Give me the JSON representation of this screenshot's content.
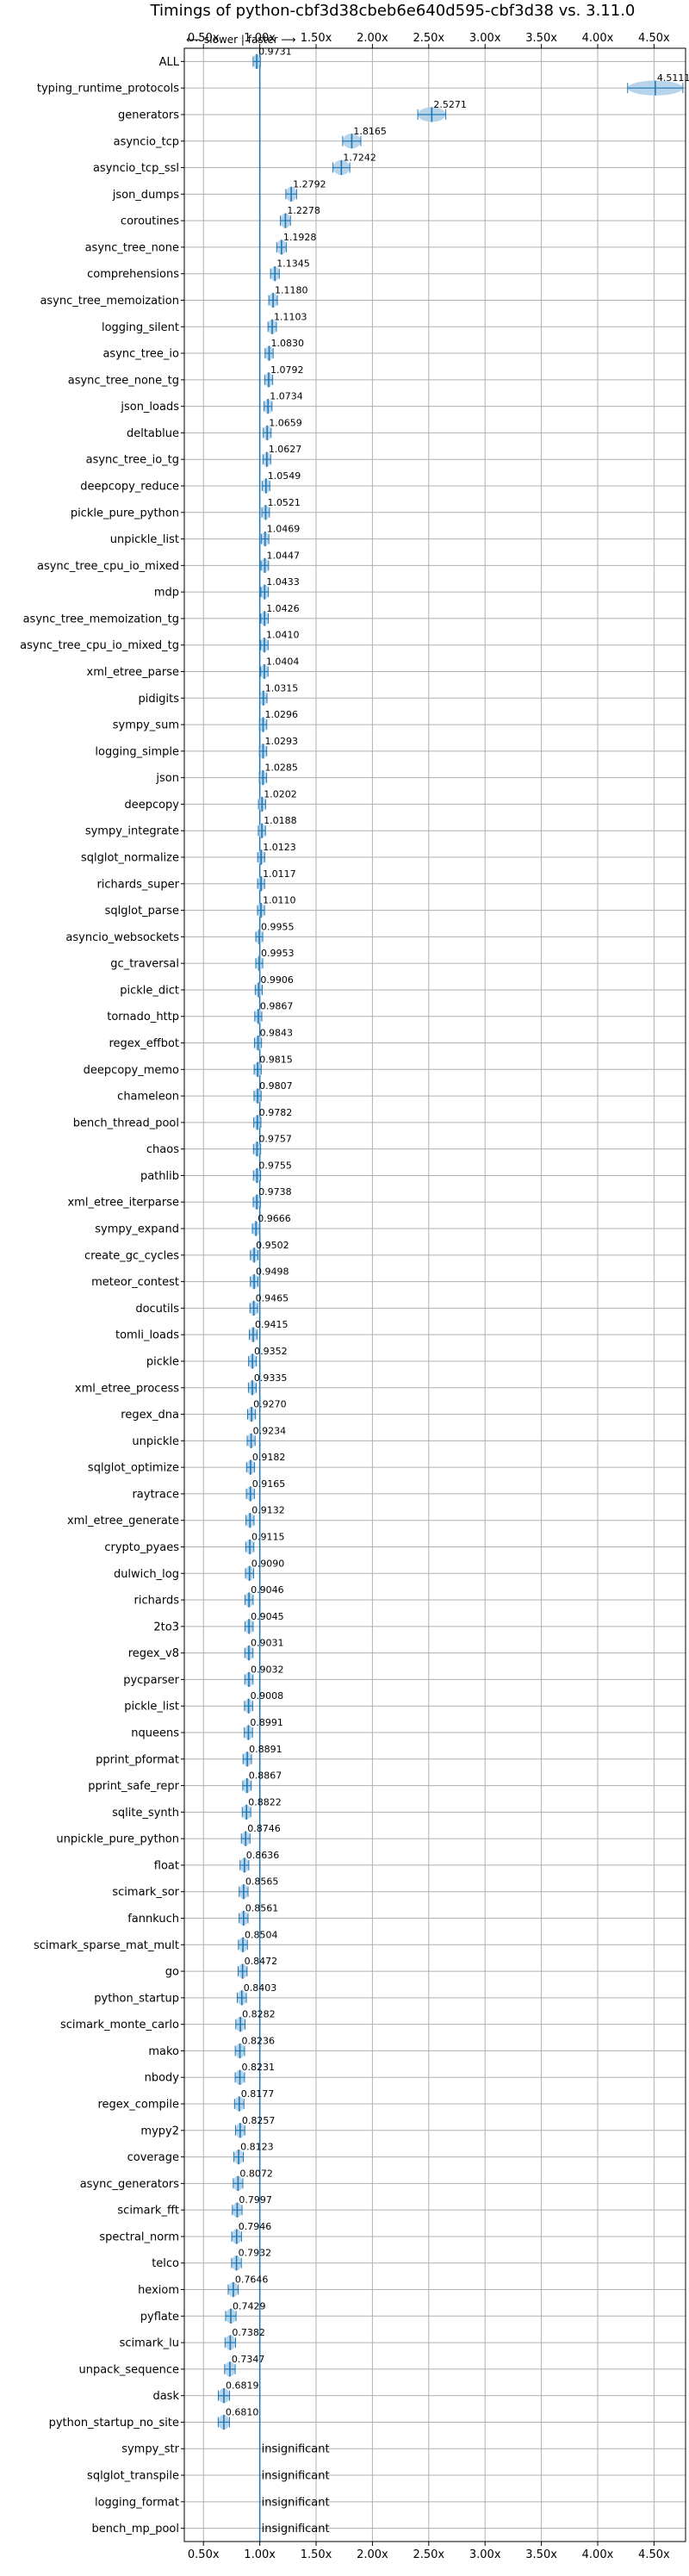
{
  "chart_data": {
    "type": "violin",
    "title": "Timings of python-cbf3d38cbeb6e640d595-cbf3d38 vs. 3.11.0",
    "direction_note": "⟵ slower | faster ⟶",
    "x_ticks": [
      "0.50x",
      "1.00x",
      "1.50x",
      "2.00x",
      "2.50x",
      "3.00x",
      "3.50x",
      "4.00x",
      "4.50x"
    ],
    "x_tick_values": [
      0.5,
      1.0,
      1.5,
      2.0,
      2.5,
      3.0,
      3.5,
      4.0,
      4.5
    ],
    "xlim": [
      0.33,
      4.78
    ],
    "reference_line": 1.0,
    "grid": true,
    "colors": {
      "violin": "#aacde6",
      "median": "#1f77b4",
      "reference": "#1f77b4",
      "mean_marker": "#d62728",
      "grid": "#b0b0b0"
    },
    "insignificant_label": "insignificant",
    "benchmarks": [
      {
        "name": "ALL",
        "value": 0.9731,
        "label": "0.9731"
      },
      {
        "name": "typing_runtime_protocols",
        "value": 4.5111,
        "label": "4.5111"
      },
      {
        "name": "generators",
        "value": 2.5271,
        "label": "2.5271"
      },
      {
        "name": "asyncio_tcp",
        "value": 1.8165,
        "label": "1.8165"
      },
      {
        "name": "asyncio_tcp_ssl",
        "value": 1.7242,
        "label": "1.7242"
      },
      {
        "name": "json_dumps",
        "value": 1.2792,
        "label": "1.2792"
      },
      {
        "name": "coroutines",
        "value": 1.2278,
        "label": "1.2278"
      },
      {
        "name": "async_tree_none",
        "value": 1.1928,
        "label": "1.1928"
      },
      {
        "name": "comprehensions",
        "value": 1.1345,
        "label": "1.1345"
      },
      {
        "name": "async_tree_memoization",
        "value": 1.118,
        "label": "1.1180"
      },
      {
        "name": "logging_silent",
        "value": 1.1103,
        "label": "1.1103"
      },
      {
        "name": "async_tree_io",
        "value": 1.083,
        "label": "1.0830"
      },
      {
        "name": "async_tree_none_tg",
        "value": 1.0792,
        "label": "1.0792"
      },
      {
        "name": "json_loads",
        "value": 1.0734,
        "label": "1.0734"
      },
      {
        "name": "deltablue",
        "value": 1.0659,
        "label": "1.0659"
      },
      {
        "name": "async_tree_io_tg",
        "value": 1.0627,
        "label": "1.0627"
      },
      {
        "name": "deepcopy_reduce",
        "value": 1.0549,
        "label": "1.0549"
      },
      {
        "name": "pickle_pure_python",
        "value": 1.0521,
        "label": "1.0521"
      },
      {
        "name": "unpickle_list",
        "value": 1.0469,
        "label": "1.0469"
      },
      {
        "name": "async_tree_cpu_io_mixed",
        "value": 1.0447,
        "label": "1.0447"
      },
      {
        "name": "mdp",
        "value": 1.0433,
        "label": "1.0433"
      },
      {
        "name": "async_tree_memoization_tg",
        "value": 1.0426,
        "label": "1.0426"
      },
      {
        "name": "async_tree_cpu_io_mixed_tg",
        "value": 1.041,
        "label": "1.0410"
      },
      {
        "name": "xml_etree_parse",
        "value": 1.0404,
        "label": "1.0404"
      },
      {
        "name": "pidigits",
        "value": 1.0315,
        "label": "1.0315"
      },
      {
        "name": "sympy_sum",
        "value": 1.0296,
        "label": "1.0296"
      },
      {
        "name": "logging_simple",
        "value": 1.0293,
        "label": "1.0293"
      },
      {
        "name": "json",
        "value": 1.0285,
        "label": "1.0285"
      },
      {
        "name": "deepcopy",
        "value": 1.0202,
        "label": "1.0202"
      },
      {
        "name": "sympy_integrate",
        "value": 1.0188,
        "label": "1.0188"
      },
      {
        "name": "sqlglot_normalize",
        "value": 1.0123,
        "label": "1.0123"
      },
      {
        "name": "richards_super",
        "value": 1.0117,
        "label": "1.0117"
      },
      {
        "name": "sqlglot_parse",
        "value": 1.011,
        "label": "1.0110"
      },
      {
        "name": "asyncio_websockets",
        "value": 0.9955,
        "label": "0.9955"
      },
      {
        "name": "gc_traversal",
        "value": 0.9953,
        "label": "0.9953"
      },
      {
        "name": "pickle_dict",
        "value": 0.9906,
        "label": "0.9906"
      },
      {
        "name": "tornado_http",
        "value": 0.9867,
        "label": "0.9867"
      },
      {
        "name": "regex_effbot",
        "value": 0.9843,
        "label": "0.9843"
      },
      {
        "name": "deepcopy_memo",
        "value": 0.9815,
        "label": "0.9815"
      },
      {
        "name": "chameleon",
        "value": 0.9807,
        "label": "0.9807"
      },
      {
        "name": "bench_thread_pool",
        "value": 0.9782,
        "label": "0.9782"
      },
      {
        "name": "chaos",
        "value": 0.9757,
        "label": "0.9757"
      },
      {
        "name": "pathlib",
        "value": 0.9755,
        "label": "0.9755"
      },
      {
        "name": "xml_etree_iterparse",
        "value": 0.9738,
        "label": "0.9738"
      },
      {
        "name": "sympy_expand",
        "value": 0.9666,
        "label": "0.9666"
      },
      {
        "name": "create_gc_cycles",
        "value": 0.9502,
        "label": "0.9502"
      },
      {
        "name": "meteor_contest",
        "value": 0.9498,
        "label": "0.9498"
      },
      {
        "name": "docutils",
        "value": 0.9465,
        "label": "0.9465"
      },
      {
        "name": "tomli_loads",
        "value": 0.9415,
        "label": "0.9415"
      },
      {
        "name": "pickle",
        "value": 0.9352,
        "label": "0.9352"
      },
      {
        "name": "xml_etree_process",
        "value": 0.9335,
        "label": "0.9335"
      },
      {
        "name": "regex_dna",
        "value": 0.927,
        "label": "0.9270"
      },
      {
        "name": "unpickle",
        "value": 0.9234,
        "label": "0.9234"
      },
      {
        "name": "sqlglot_optimize",
        "value": 0.9182,
        "label": "0.9182"
      },
      {
        "name": "raytrace",
        "value": 0.9165,
        "label": "0.9165"
      },
      {
        "name": "xml_etree_generate",
        "value": 0.9132,
        "label": "0.9132"
      },
      {
        "name": "crypto_pyaes",
        "value": 0.9115,
        "label": "0.9115"
      },
      {
        "name": "dulwich_log",
        "value": 0.909,
        "label": "0.9090"
      },
      {
        "name": "richards",
        "value": 0.9046,
        "label": "0.9046"
      },
      {
        "name": "2to3",
        "value": 0.9045,
        "label": "0.9045"
      },
      {
        "name": "regex_v8",
        "value": 0.9031,
        "label": "0.9031"
      },
      {
        "name": "pycparser",
        "value": 0.9032,
        "label": "0.9032"
      },
      {
        "name": "pickle_list",
        "value": 0.9008,
        "label": "0.9008"
      },
      {
        "name": "nqueens",
        "value": 0.8991,
        "label": "0.8991"
      },
      {
        "name": "pprint_pformat",
        "value": 0.8891,
        "label": "0.8891"
      },
      {
        "name": "pprint_safe_repr",
        "value": 0.8867,
        "label": "0.8867"
      },
      {
        "name": "sqlite_synth",
        "value": 0.8822,
        "label": "0.8822"
      },
      {
        "name": "unpickle_pure_python",
        "value": 0.8746,
        "label": "0.8746"
      },
      {
        "name": "float",
        "value": 0.8636,
        "label": "0.8636"
      },
      {
        "name": "scimark_sor",
        "value": 0.8565,
        "label": "0.8565"
      },
      {
        "name": "fannkuch",
        "value": 0.8561,
        "label": "0.8561"
      },
      {
        "name": "scimark_sparse_mat_mult",
        "value": 0.8504,
        "label": "0.8504"
      },
      {
        "name": "go",
        "value": 0.8472,
        "label": "0.8472"
      },
      {
        "name": "python_startup",
        "value": 0.8403,
        "label": "0.8403"
      },
      {
        "name": "scimark_monte_carlo",
        "value": 0.8282,
        "label": "0.8282"
      },
      {
        "name": "mako",
        "value": 0.8236,
        "label": "0.8236"
      },
      {
        "name": "nbody",
        "value": 0.8231,
        "label": "0.8231"
      },
      {
        "name": "regex_compile",
        "value": 0.8177,
        "label": "0.8177"
      },
      {
        "name": "mypy2",
        "value": 0.8257,
        "label": "0.8257"
      },
      {
        "name": "coverage",
        "value": 0.8123,
        "label": "0.8123"
      },
      {
        "name": "async_generators",
        "value": 0.8072,
        "label": "0.8072"
      },
      {
        "name": "scimark_fft",
        "value": 0.7997,
        "label": "0.7997"
      },
      {
        "name": "spectral_norm",
        "value": 0.7946,
        "label": "0.7946"
      },
      {
        "name": "telco",
        "value": 0.7932,
        "label": "0.7932"
      },
      {
        "name": "hexiom",
        "value": 0.7646,
        "label": "0.7646"
      },
      {
        "name": "pyflate",
        "value": 0.7429,
        "label": "0.7429"
      },
      {
        "name": "scimark_lu",
        "value": 0.7382,
        "label": "0.7382"
      },
      {
        "name": "unpack_sequence",
        "value": 0.7347,
        "label": "0.7347"
      },
      {
        "name": "dask",
        "value": 0.6819,
        "label": "0.6819"
      },
      {
        "name": "python_startup_no_site",
        "value": 0.681,
        "label": "0.6810"
      },
      {
        "name": "sympy_str",
        "value": null,
        "label": "insignificant"
      },
      {
        "name": "sqlglot_transpile",
        "value": null,
        "label": "insignificant"
      },
      {
        "name": "logging_format",
        "value": null,
        "label": "insignificant"
      },
      {
        "name": "bench_mp_pool",
        "value": null,
        "label": "insignificant"
      }
    ]
  }
}
